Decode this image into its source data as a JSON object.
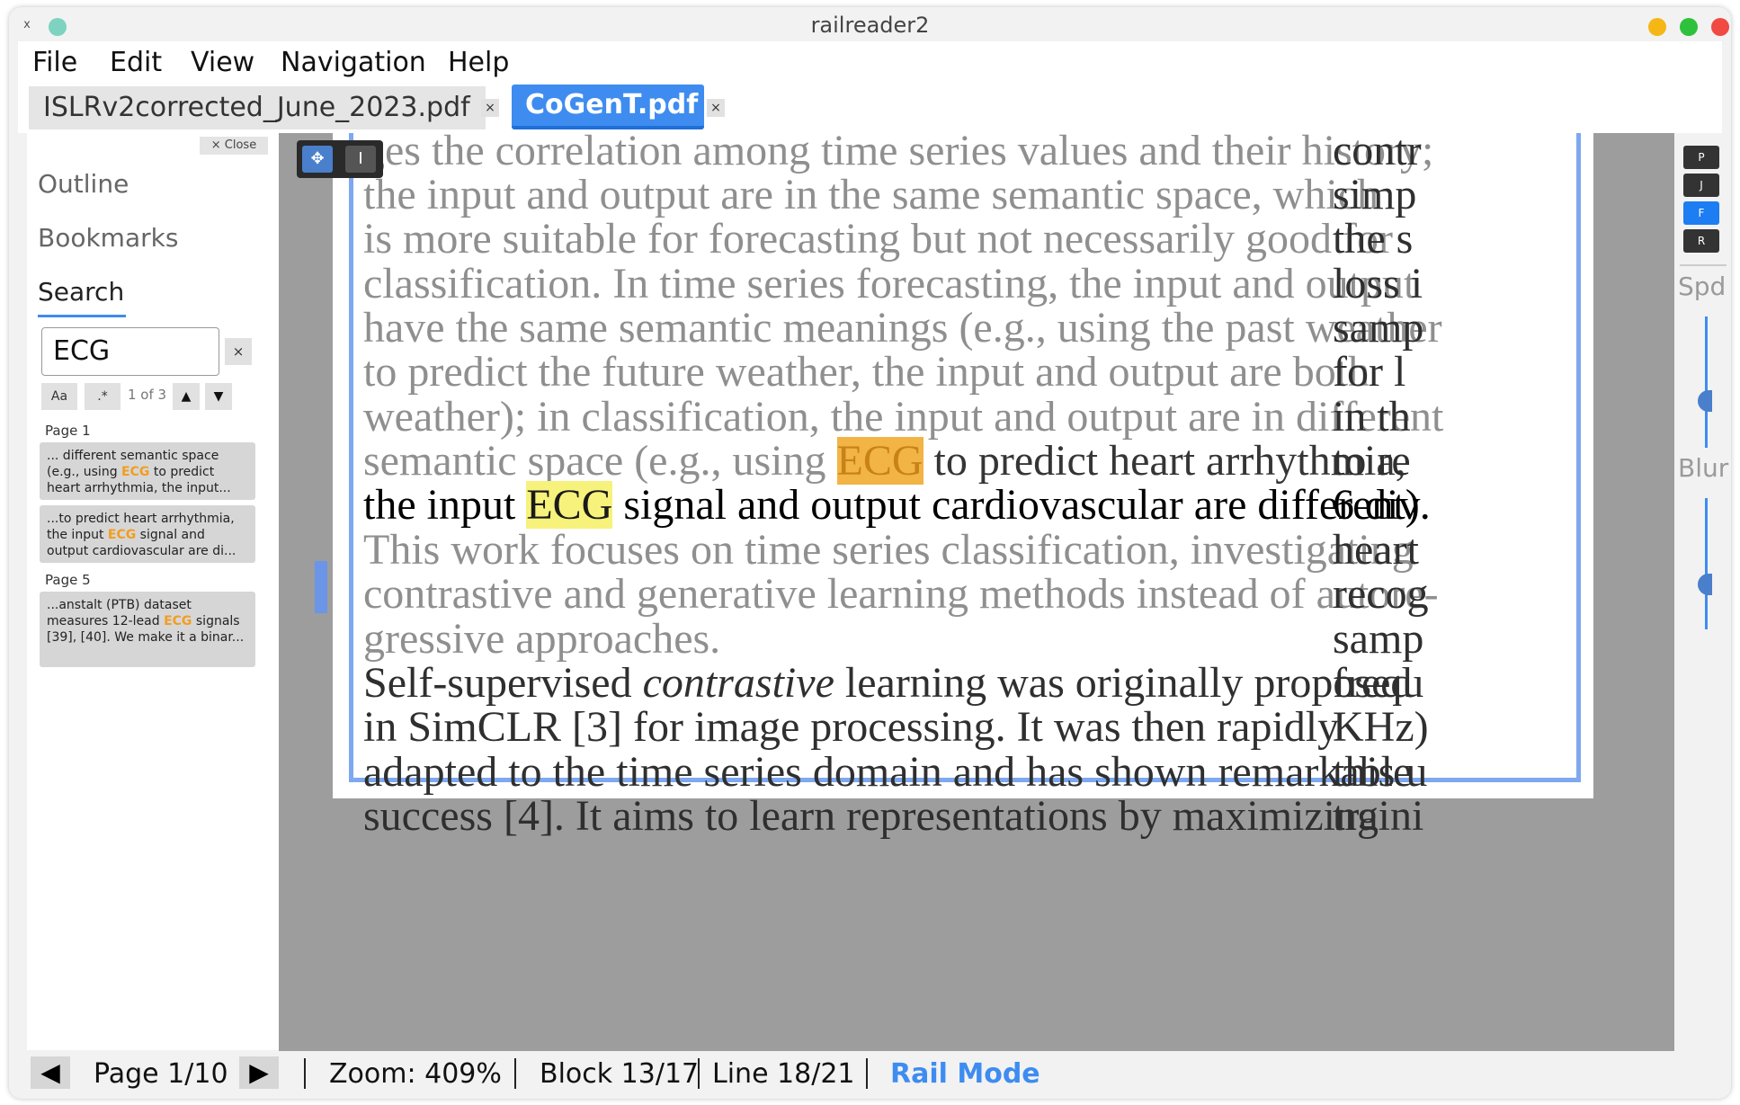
{
  "window": {
    "title": "railreader2",
    "close_glyph": "x"
  },
  "menu": [
    "File",
    "Edit",
    "View",
    "Navigation",
    "Help"
  ],
  "tabs": [
    {
      "label": "ISLRv2corrected_June_2023.pdf",
      "close": "×"
    },
    {
      "label": "CoGenT.pdf",
      "close": "×"
    }
  ],
  "sidebar": {
    "close_label": "× Close",
    "outline": "Outline",
    "bookmarks": "Bookmarks",
    "search": "Search",
    "query": "ECG",
    "clear": "×",
    "case_btn": "Aa",
    "regex_btn": ".*",
    "count": "1 of 3",
    "prev": "▲",
    "next": "▼",
    "results": [
      {
        "page": "Page 1",
        "before": "... different  semantic space (e.g., using ",
        "match": "ECG",
        "after": "  to predict heart arrhythmia,  the input..."
      },
      {
        "page": "",
        "before": "...to predict heart arrhythmia, the input ",
        "match": "ECG",
        "after": "  signal and output cardiovascular are di..."
      },
      {
        "page": "Page 5",
        "before": "...anstalt (PTB) dataset measures 12-lead ",
        "match": "ECG",
        "after": " signals [39], [40]. We make it a binar..."
      }
    ]
  },
  "doc": {
    "lines": [
      {
        "t": "ges the correlation among time series values and their history;"
      },
      {
        "t": "the input and output are in the same semantic space, which"
      },
      {
        "t": "is more suitable for forecasting but not necessarily good for"
      },
      {
        "t": "classification. In time series forecasting, the input and output"
      },
      {
        "t": "have the same semantic meanings (e.g., using the past weather"
      },
      {
        "t": "to predict the future weather, the input and output are both"
      },
      {
        "t": "weather); in classification, the input and output are in different"
      },
      {
        "pre": "semantic space (e.g., using ",
        "hl": "ECG",
        "post": " to predict heart arrhythmia,"
      },
      {
        "pre": "the input ",
        "hl": "ECG",
        "post": " signal and output cardiovascular are different)."
      },
      {
        "t": "This work focuses on time series classification, investigating"
      },
      {
        "t": "contrastive and generative learning methods instead of autore-"
      },
      {
        "t": "gressive approaches."
      },
      {
        "pre": "Self-supervised ",
        "it": "contrastive",
        "post": " learning was originally proposed"
      },
      {
        "t": "in SimCLR [3] for image processing. It was then rapidly"
      },
      {
        "t": "adapted to the time series domain and has shown remarkable"
      },
      {
        "t": "success [4]. It aims to learn representations by maximizing"
      }
    ],
    "right_col": [
      "contr",
      "simp",
      "the s",
      "loss i",
      "samp",
      "for l",
      "in th",
      "to re",
      "6 div",
      "heart",
      "recog",
      "samp",
      "frequ",
      "KHz)",
      "this u",
      "traini"
    ]
  },
  "tools": {
    "move": "✥",
    "text": "I"
  },
  "right_panel": {
    "keys": [
      "P",
      "J",
      "F",
      "R"
    ],
    "spd": "Spd",
    "blur": "Blur"
  },
  "status": {
    "prev": "◀",
    "page": "Page 1/10",
    "next": "▶",
    "zoom": "Zoom: 409%",
    "block": "Block 13/17",
    "line": "Line 18/21",
    "mode": "Rail Mode"
  },
  "colors": {
    "accent": "#3e8cf0",
    "highlight_current": "#f2b444",
    "highlight_other": "#f7f27c"
  }
}
